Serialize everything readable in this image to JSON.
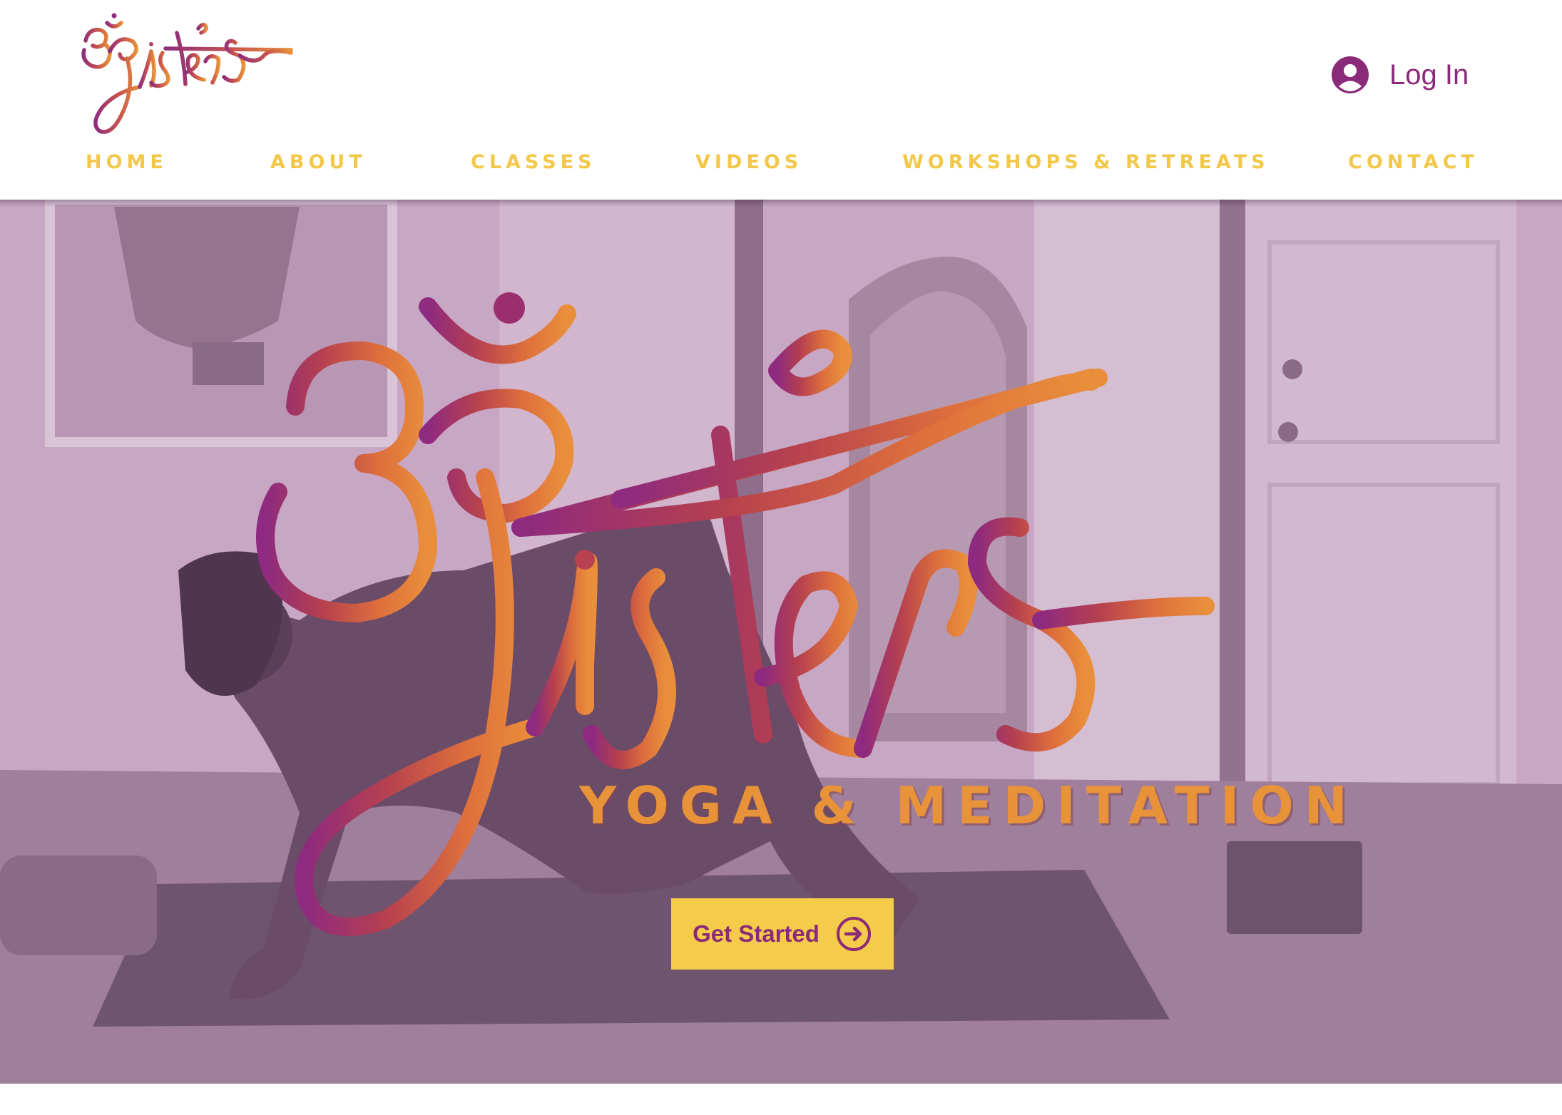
{
  "header": {
    "logo_alt": "Om Sisters",
    "login_label": "Log In"
  },
  "nav": {
    "items": [
      {
        "label": "HOME"
      },
      {
        "label": "ABOUT"
      },
      {
        "label": "CLASSES"
      },
      {
        "label": "VIDEOS"
      },
      {
        "label": "WORKSHOPS & RETREATS"
      },
      {
        "label": "CONTACT"
      }
    ]
  },
  "hero": {
    "tagline": "YOGA & MEDITATION",
    "cta_label": "Get Started"
  },
  "colors": {
    "brand_purple": "#8a2a78",
    "brand_orange": "#e8923a",
    "nav_yellow": "#f3c84a",
    "cta_yellow": "#f5cc4a",
    "hero_tint": "#c4a2c1"
  },
  "icons": {
    "login": "user-avatar-icon",
    "cta": "arrow-right-circle-icon"
  }
}
